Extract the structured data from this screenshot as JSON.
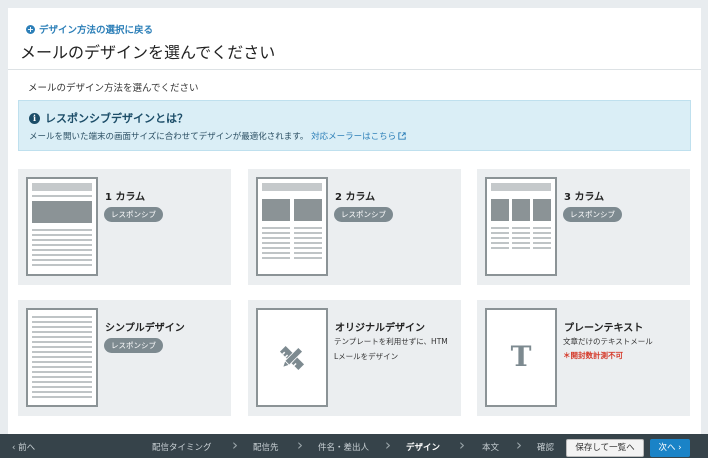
{
  "header": {
    "back_link": "デザイン方法の選択に戻る",
    "title": "メールのデザインを選んでください",
    "subtitle": "メールのデザイン方法を選んでください"
  },
  "info": {
    "title": "レスポンシブデザインとは？",
    "text": "メールを開いた端末の画面サイズに合わせてデザインが最適化されます。",
    "link": "対応メーラーはこちら"
  },
  "cards": [
    {
      "title": "1 カラム",
      "badge": "レスポンシブ"
    },
    {
      "title": "2 カラム",
      "badge": "レスポンシブ"
    },
    {
      "title": "3 カラム",
      "badge": "レスポンシブ"
    },
    {
      "title": "シンプルデザイン",
      "badge": "レスポンシブ"
    },
    {
      "title": "オリジナルデザイン",
      "desc1": "テンプレートを利用せずに、HTM",
      "desc2": "Lメールをデザイン"
    },
    {
      "title": "プレーンテキスト",
      "desc1": "文章だけのテキストメール",
      "warn": "＊開封数計測不可"
    }
  ],
  "footer": {
    "prev": "前へ",
    "steps": [
      "配信タイミング",
      "配信先",
      "件名・差出人",
      "デザイン",
      "本文",
      "確認"
    ],
    "active_step": "デザイン",
    "save": "保存して一覧へ",
    "next": "次へ"
  },
  "colors": {
    "accent": "#1a83c7",
    "info_bg": "#daeef6",
    "warn": "#d53b2b",
    "footer_bg": "#36434a"
  }
}
